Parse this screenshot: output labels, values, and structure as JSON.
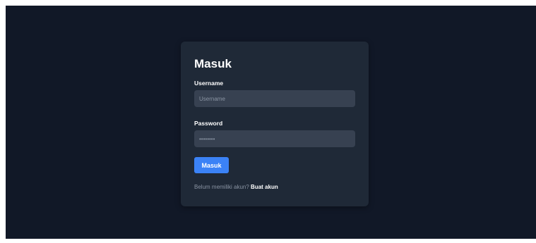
{
  "login": {
    "title": "Masuk",
    "username_label": "Username",
    "username_placeholder": "Username",
    "password_label": "Password",
    "password_placeholder": "••••••••",
    "submit_label": "Masuk",
    "register_prompt": "Belum memiliki akun?",
    "register_link": "Buat akun"
  },
  "colors": {
    "background": "#111827",
    "card": "#1f2937",
    "input": "#374151",
    "accent": "#3b82f6"
  }
}
